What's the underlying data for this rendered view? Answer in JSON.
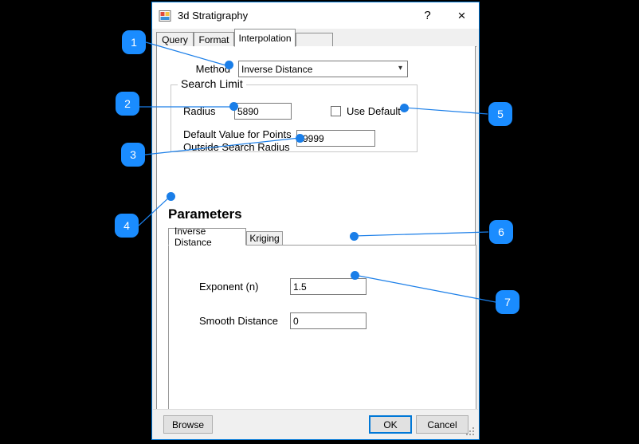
{
  "window": {
    "title": "3d Stratigraphy",
    "icon": "form-designer-icon",
    "help_button": "?",
    "close_button": "×"
  },
  "tabs": [
    {
      "label": "Query",
      "active": false
    },
    {
      "label": "Format",
      "active": false
    },
    {
      "label": "Interpolation",
      "active": true
    }
  ],
  "interpolation": {
    "method_label": "Method",
    "method_value": "Inverse Distance",
    "method_options": [
      "Inverse Distance",
      "Kriging"
    ],
    "search_limit": {
      "title": "Search Limit",
      "radius_label": "Radius",
      "radius_value": "5890",
      "use_default_label": "Use Default",
      "use_default_checked": false,
      "default_value_label_line1": "Default Value for Points",
      "default_value_label_line2": "Outside Search Radius",
      "default_value": "-9999"
    },
    "parameters": {
      "heading": "Parameters",
      "tabs": [
        {
          "label": "Inverse Distance",
          "active": true
        },
        {
          "label": "Kriging",
          "active": false
        }
      ],
      "exponent_label": "Exponent (n)",
      "exponent_value": "1.5",
      "smooth_distance_label": "Smooth Distance",
      "smooth_distance_value": "0"
    }
  },
  "footer": {
    "browse_label": "Browse",
    "ok_label": "OK",
    "cancel_label": "Cancel"
  },
  "annotations": [
    {
      "number": "1"
    },
    {
      "number": "2"
    },
    {
      "number": "3"
    },
    {
      "number": "4"
    },
    {
      "number": "5"
    },
    {
      "number": "6"
    },
    {
      "number": "7"
    }
  ],
  "colors": {
    "accent": "#0078d7",
    "annotation": "#1a8cff",
    "background": "#000000",
    "dialog": "#f0f0f0"
  }
}
